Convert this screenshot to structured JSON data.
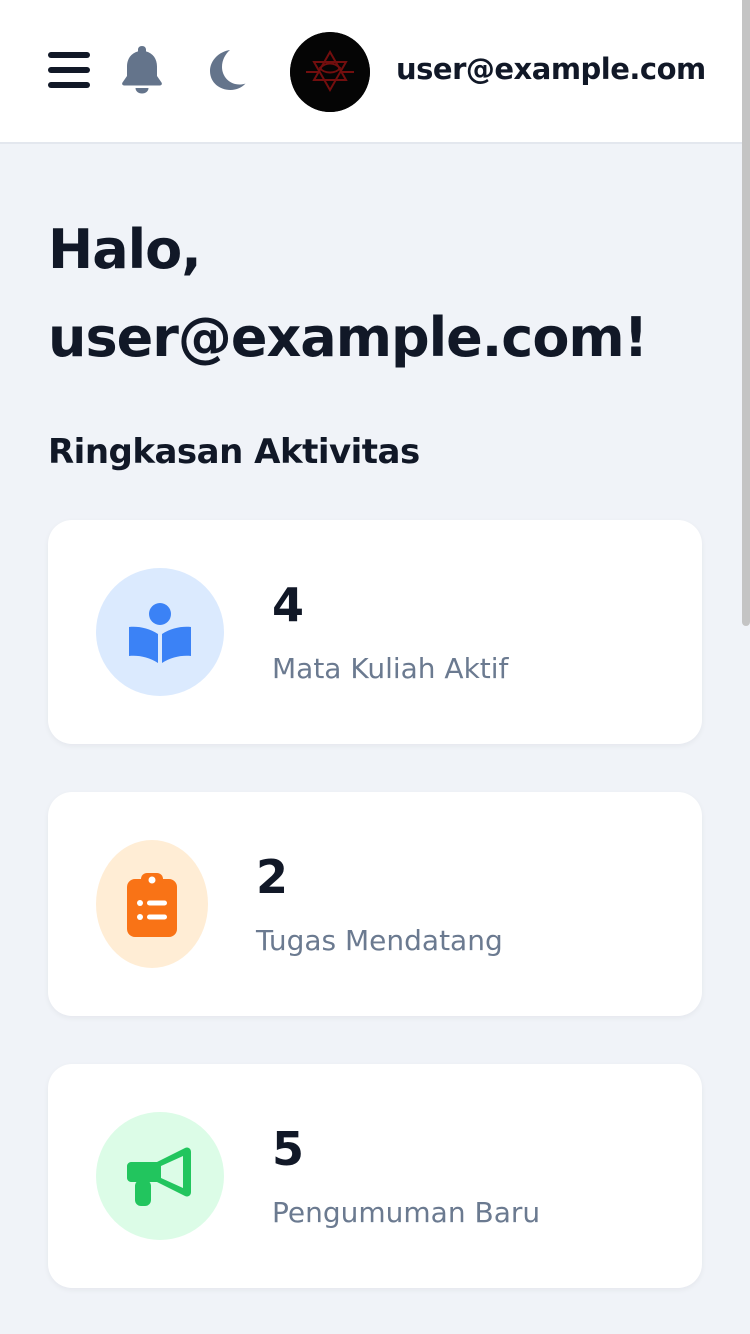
{
  "header": {
    "menu_icon": "menu-icon",
    "bell_icon": "bell-icon",
    "moon_icon": "moon-icon",
    "user_email": "user@example.com"
  },
  "greeting": {
    "prefix": "Halo,",
    "name": "user@example.com!"
  },
  "summary": {
    "title": "Ringkasan Aktivitas",
    "cards": [
      {
        "value": "4",
        "label": "Mata Kuliah Aktif",
        "icon": "book-reader-icon",
        "icon_color": "#3b82f6",
        "bg_color": "#dbeafe"
      },
      {
        "value": "2",
        "label": "Tugas Mendatang",
        "icon": "clipboard-list-icon",
        "icon_color": "#f97316",
        "bg_color": "#ffedd5"
      },
      {
        "value": "5",
        "label": "Pengumuman Baru",
        "icon": "megaphone-icon",
        "icon_color": "#22c55e",
        "bg_color": "#dcfce7"
      }
    ]
  },
  "colors": {
    "text_primary": "#111827",
    "text_muted": "#6b7a90",
    "icon_gray": "#64748b",
    "page_bg": "#f0f3f8"
  }
}
